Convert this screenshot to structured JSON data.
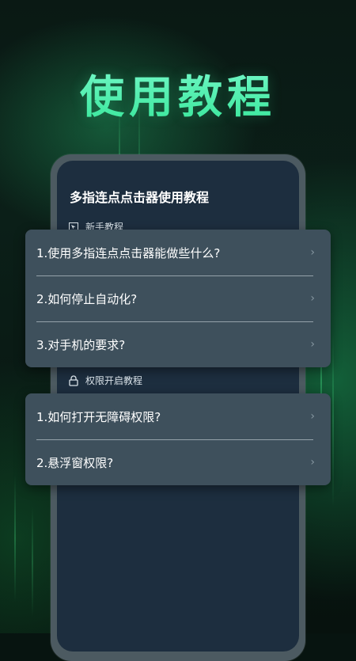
{
  "hero": {
    "title": "使用教程"
  },
  "phone": {
    "title": "多指连点点击器使用教程"
  },
  "sections": {
    "beginner": {
      "label": "新手教程",
      "icon": "pointer-icon"
    },
    "permission": {
      "label": "权限开启教程",
      "icon": "lock-icon"
    }
  },
  "faq_beginner": [
    {
      "label": "1.使用多指连点点击器能做些什么?"
    },
    {
      "label": "2.如何停止自动化?"
    },
    {
      "label": "3.对手机的要求?"
    }
  ],
  "faq_permission": [
    {
      "label": "1.如何打开无障碍权限?"
    },
    {
      "label": "2.悬浮窗权限?"
    }
  ],
  "colors": {
    "accent": "#38e69a",
    "card": "#3e505c",
    "screen": "#1d2e3f"
  }
}
